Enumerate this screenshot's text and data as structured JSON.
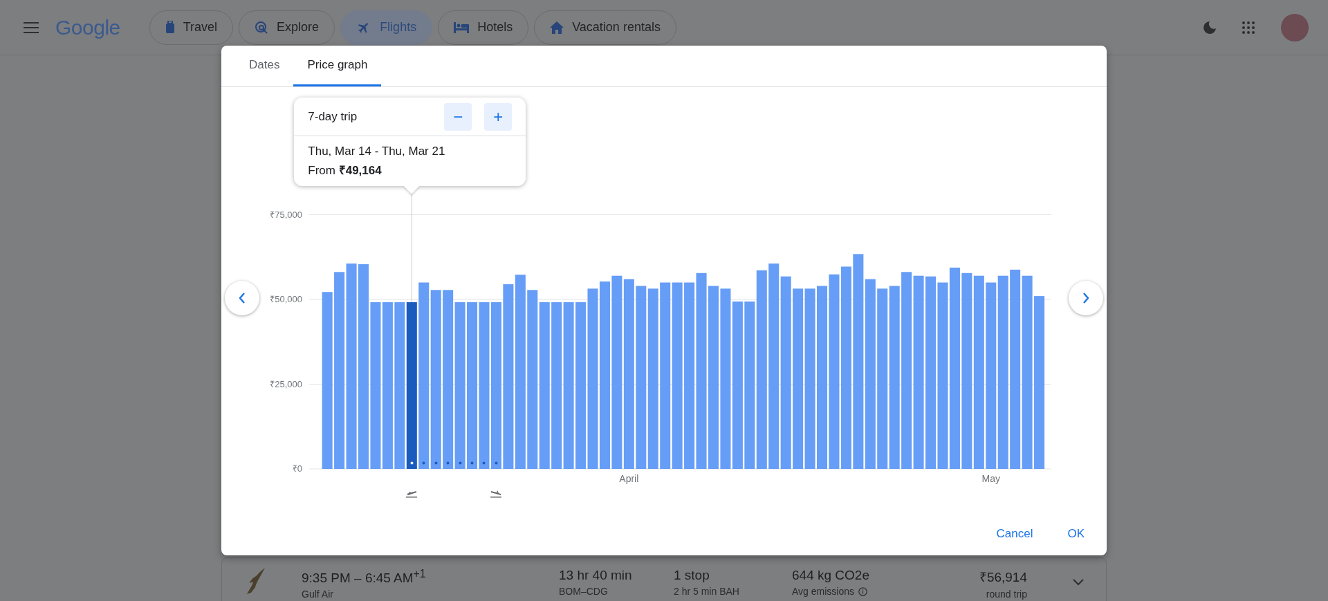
{
  "top_bar": {
    "logo": "Google",
    "nav_chips": [
      {
        "label": "Travel",
        "selected": false
      },
      {
        "label": "Explore",
        "selected": false
      },
      {
        "label": "Flights",
        "selected": true
      },
      {
        "label": "Hotels",
        "selected": false
      },
      {
        "label": "Vacation rentals",
        "selected": false
      }
    ]
  },
  "dialog": {
    "tabs": [
      {
        "label": "Dates",
        "selected": false
      },
      {
        "label": "Price graph",
        "selected": true
      }
    ],
    "trip_popup": {
      "duration": "7-day trip",
      "minus": "−",
      "plus": "+",
      "dates": "Thu, Mar 14 - Thu, Mar 21",
      "price": "From **₹49,164**"
    },
    "price_graph": {
      "chart_data": {
        "type": "bar",
        "stacked": true,
        "categories": [
          null,
          null,
          null,
          null,
          null,
          null,
          null,
          null,
          null,
          null,
          null,
          null,
          null,
          null,
          null,
          null,
          null,
          null,
          null,
          null,
          null,
          null,
          null,
          null,
          null,
          "April",
          null,
          null,
          null,
          null,
          null,
          null,
          null,
          null,
          null,
          null,
          null,
          null,
          null,
          null,
          null,
          null,
          null,
          null,
          null,
          null,
          null,
          null,
          null,
          null,
          null,
          null,
          null,
          null,
          null,
          "May",
          null,
          null,
          null,
          null
        ],
        "series": [
          {
            "color": "#669df6",
            "values": [
              52200,
              58100,
              60600,
              60400,
              49200,
              49200,
              49200,
              null,
              55000,
              52800,
              52800,
              49200,
              49200,
              49200,
              49200,
              54500,
              57300,
              52800,
              49200,
              49200,
              49200,
              49200,
              53200,
              55300,
              57000,
              56000,
              54000,
              53200,
              55000,
              55000,
              55000,
              57800,
              54000,
              53200,
              49400,
              49400,
              58600,
              60600,
              56800,
              53200,
              53200,
              54000,
              57400,
              59700,
              63400,
              56000,
              53200,
              54000,
              58100,
              57000,
              56800,
              55000,
              59400,
              57800,
              57000,
              55000,
              57000,
              58800,
              57000,
              51000
            ]
          },
          {
            "color": "#1a5bbd",
            "values": [
              null,
              null,
              null,
              null,
              null,
              null,
              null,
              49200,
              null,
              null,
              null,
              null,
              null,
              null,
              null,
              null,
              null,
              null,
              null,
              null,
              null,
              null,
              null,
              null,
              null,
              null,
              null,
              null,
              null,
              null,
              null,
              null,
              null,
              null,
              null,
              null,
              null,
              null,
              null,
              null,
              null,
              null,
              null,
              null,
              null,
              null,
              null,
              null,
              null,
              null,
              null,
              null,
              null,
              null,
              null,
              null,
              null,
              null,
              null,
              null
            ]
          }
        ],
        "ylim": [
          0,
          75000
        ],
        "yticks": [
          {
            "value": 0,
            "label": "₹0"
          },
          {
            "value": 25000,
            "label": "₹25,000"
          },
          {
            "value": 50000,
            "label": "₹50,000"
          },
          {
            "value": 75000,
            "label": "₹75,000"
          }
        ]
      },
      "trip_dots": [
        {
          "selected": true
        },
        {
          "selected": false
        },
        {
          "selected": false
        },
        {
          "selected": false
        },
        {
          "selected": false
        },
        {
          "selected": false
        },
        {
          "selected": false
        },
        {
          "selected": false
        }
      ]
    },
    "buttons": [
      "Cancel",
      "OK"
    ]
  },
  "flight_row": {
    "times": "9:35 PM – 6:45 AM$^{+1}$",
    "airline": "Gulf Air",
    "duration": "13 hr 40 min",
    "route": "BOM–CDG",
    "stops": "1 stop",
    "layover": "2 hr 5 min BAH",
    "emissions": "644 kg CO2e",
    "emissions_note": "Avg emissions",
    "price": "₹56,914",
    "price_note": "round trip"
  }
}
